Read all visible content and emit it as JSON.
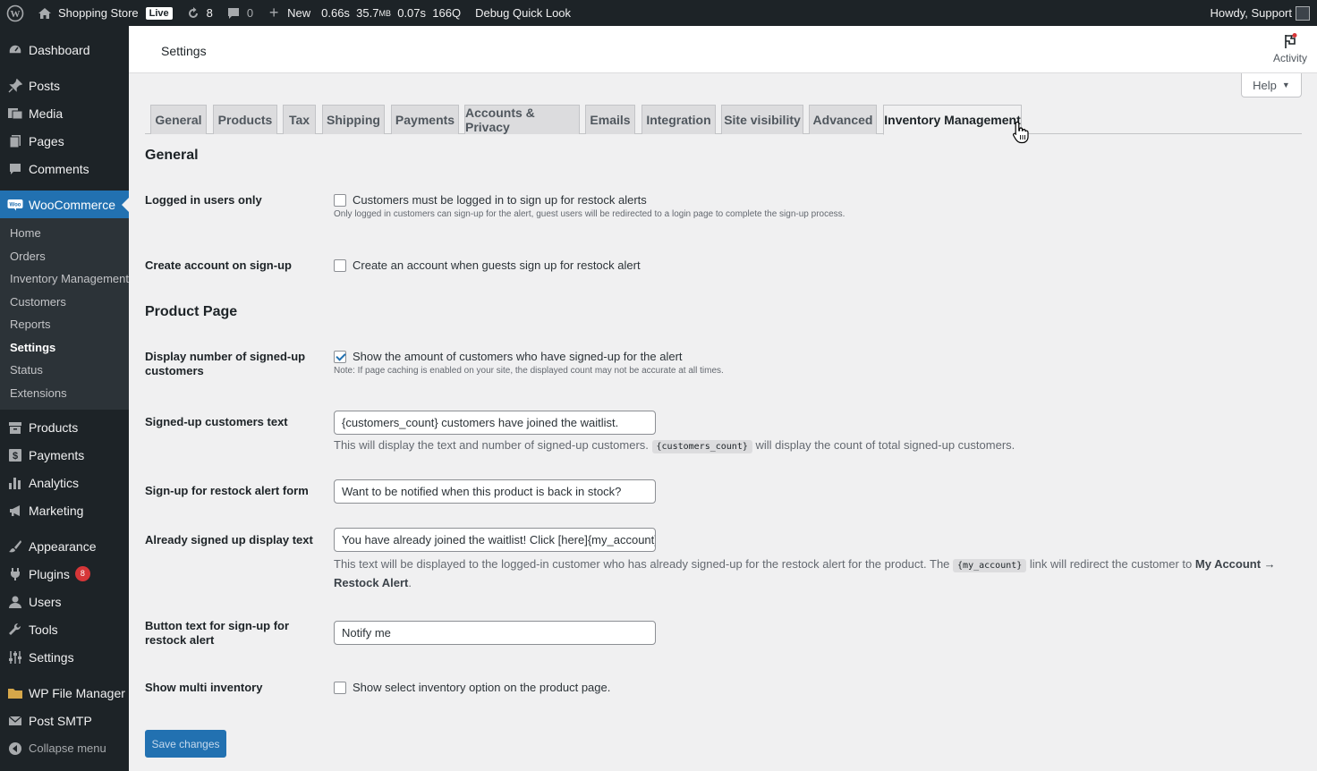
{
  "adminbar": {
    "site_name": "Shopping Store",
    "live_badge": "Live",
    "updates_count": "8",
    "comments_count": "0",
    "new_label": "New",
    "perf_time": "0.66s",
    "perf_mem": "35.7",
    "perf_mem_unit": "MB",
    "perf_query_time": "0.07s",
    "perf_queries": "166Q",
    "debug_label": "Debug Quick Look",
    "howdy": "Howdy, Support"
  },
  "sidebar": {
    "dashboard": "Dashboard",
    "posts": "Posts",
    "media": "Media",
    "pages": "Pages",
    "comments": "Comments",
    "woocommerce": "WooCommerce",
    "woo_sub": [
      "Home",
      "Orders",
      "Inventory Management",
      "Customers",
      "Reports",
      "Settings",
      "Status",
      "Extensions"
    ],
    "products": "Products",
    "payments": "Payments",
    "analytics": "Analytics",
    "marketing": "Marketing",
    "appearance": "Appearance",
    "plugins": "Plugins",
    "plugins_badge": "8",
    "users": "Users",
    "tools": "Tools",
    "settings": "Settings",
    "file_manager": "WP File Manager",
    "post_smtp": "Post SMTP",
    "collapse": "Collapse menu"
  },
  "header": {
    "title": "Settings",
    "activity": "Activity",
    "help": "Help"
  },
  "tabs": [
    "General",
    "Products",
    "Tax",
    "Shipping",
    "Payments",
    "Accounts & Privacy",
    "Emails",
    "Integration",
    "Site visibility",
    "Advanced",
    "Inventory Management"
  ],
  "sections": {
    "general": "General",
    "product_page": "Product Page"
  },
  "fields": {
    "logged_in_label": "Logged in users only",
    "logged_in_cb": "Customers must be logged in to sign up for restock alerts",
    "logged_in_note": "Only logged in customers can sign-up for the alert, guest users will be redirected to a login page to complete the sign-up process.",
    "create_account_label": "Create account on sign-up",
    "create_account_cb": "Create an account when guests sign up for restock alert",
    "display_number_label": "Display number of signed-up customers",
    "display_number_cb": "Show the amount of customers who have signed-up for the alert",
    "display_number_note": "Note: If page caching is enabled on your site, the displayed count may not be accurate at all times.",
    "signed_text_label": "Signed-up customers text",
    "signed_text_value": "{customers_count} customers have joined the waitlist.",
    "signed_text_desc_pre": "This will display the text and number of signed-up customers.",
    "signed_text_code": "{customers_count}",
    "signed_text_desc_post": "will display the count of total signed-up customers.",
    "form_label": "Sign-up for restock alert form",
    "form_value": "Want to be notified when this product is back in stock?",
    "already_label": "Already signed up display text",
    "already_value": "You have already joined the waitlist! Click [here]{my_account} t",
    "already_desc_pre": "This text will be displayed to the logged-in customer who has already signed-up for the restock alert for the product. The",
    "already_code": "{my_account}",
    "already_desc_mid": "link will redirect the customer to",
    "already_desc_bold": "My Account → Restock Alert",
    "already_desc_end": ".",
    "button_text_label": "Button text for sign-up for restock alert",
    "button_text_value": "Notify me",
    "multi_inv_label": "Show multi inventory",
    "multi_inv_cb": "Show select inventory option on the product page."
  },
  "save_button": "Save changes",
  "colors": {
    "admin_dark": "#1d2327",
    "accent": "#2271b1",
    "badge": "#d63638"
  }
}
